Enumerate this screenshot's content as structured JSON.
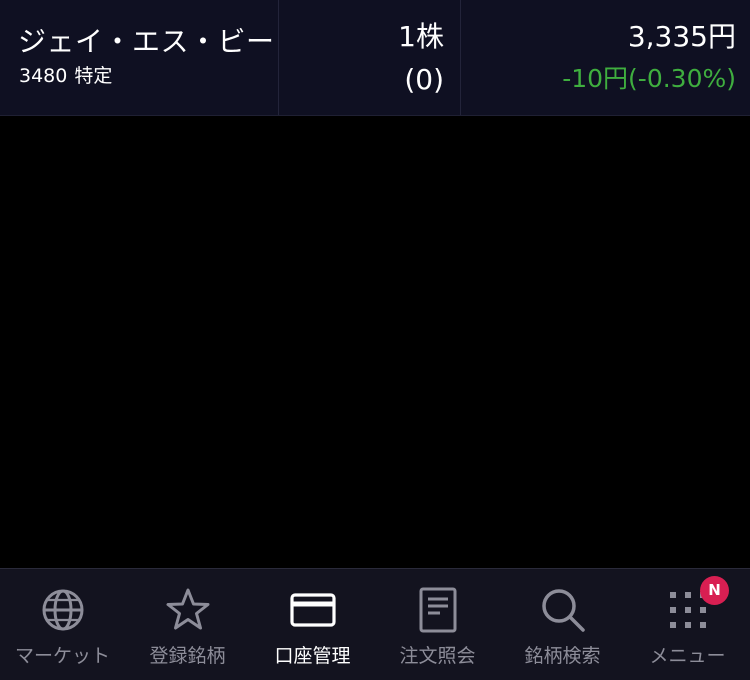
{
  "holding": {
    "name": "ジェイ・エス・ビー",
    "code": "3480",
    "account_type": "特定",
    "quantity": "1株",
    "pending": "(0)",
    "price": "3,335円",
    "change": "-10円(-0.30%)",
    "change_color": "#3fae3f"
  },
  "tabbar": {
    "tabs": [
      {
        "label": "マーケット",
        "icon": "globe-icon",
        "active": false
      },
      {
        "label": "登録銘柄",
        "icon": "star-icon",
        "active": false
      },
      {
        "label": "口座管理",
        "icon": "card-icon",
        "active": true
      },
      {
        "label": "注文照会",
        "icon": "document-icon",
        "active": false
      },
      {
        "label": "銘柄検索",
        "icon": "search-icon",
        "active": false
      },
      {
        "label": "メニュー",
        "icon": "grid-icon",
        "active": false
      }
    ],
    "menu_badge": "N",
    "badge_color": "#d81f52",
    "active_color": "#ffffff",
    "inactive_color": "#8d8d99"
  }
}
